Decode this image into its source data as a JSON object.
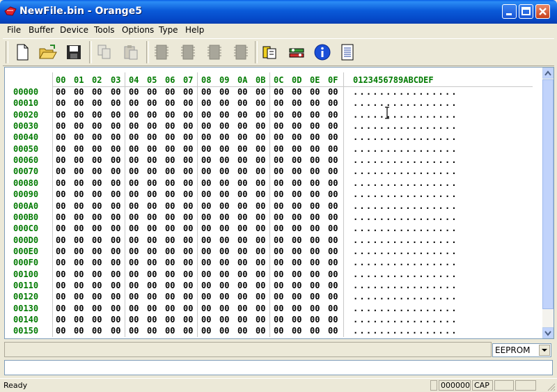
{
  "window": {
    "title": "NewFile.bin - Orange5"
  },
  "menu": [
    "File",
    "Buffer",
    "Device",
    "Tools",
    "Options",
    "Type",
    "Help"
  ],
  "toolbar": {
    "icons": [
      "new-file-icon",
      "open-folder-icon",
      "save-icon",
      "copy-icon",
      "paste-icon",
      "chip-icon",
      "chip-icon",
      "chip-icon",
      "chip-icon",
      "device-settings-icon",
      "tools-icon",
      "info-icon",
      "notes-icon"
    ]
  },
  "hex": {
    "columns": [
      "00",
      "01",
      "02",
      "03",
      "04",
      "05",
      "06",
      "07",
      "08",
      "09",
      "0A",
      "0B",
      "0C",
      "0D",
      "0E",
      "0F"
    ],
    "ascii_header": "0123456789ABCDEF",
    "addresses": [
      "00000",
      "00010",
      "00020",
      "00030",
      "00040",
      "00050",
      "00060",
      "00070",
      "00080",
      "00090",
      "000A0",
      "000B0",
      "000C0",
      "000D0",
      "000E0",
      "000F0",
      "00100",
      "00110",
      "00120",
      "00130",
      "00140",
      "00150"
    ],
    "byte_value": "00",
    "ascii_value": "................"
  },
  "device_select": {
    "value": "EEPROM"
  },
  "status": {
    "text": "Ready",
    "offset": "000000",
    "caps": "CAP"
  }
}
